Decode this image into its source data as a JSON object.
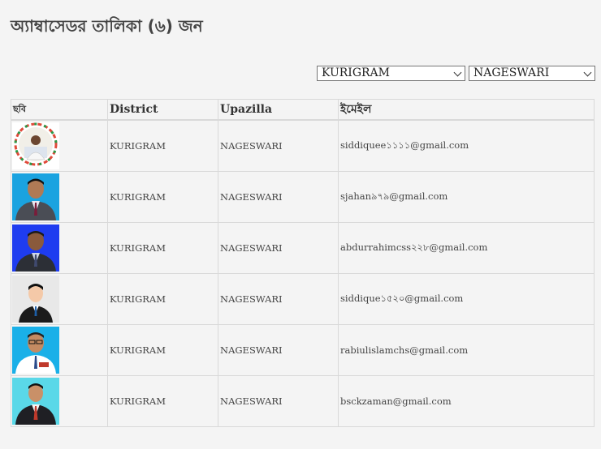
{
  "page": {
    "title": "অ্যাম্বাসেডর তালিকা (৬) জন"
  },
  "filters": {
    "district": "KURIGRAM",
    "upazilla": "NAGESWARI"
  },
  "table": {
    "headers": [
      "ছবি",
      "District",
      "Upazilla",
      "ইমেইল"
    ],
    "rows": [
      {
        "district": "KURIGRAM",
        "upazilla": "NAGESWARI",
        "email": "siddiquee১১১১@gmail.com"
      },
      {
        "district": "KURIGRAM",
        "upazilla": "NAGESWARI",
        "email": "sjahan৯৭৯@gmail.com"
      },
      {
        "district": "KURIGRAM",
        "upazilla": "NAGESWARI",
        "email": "abdurrahimcss২২৮@gmail.com"
      },
      {
        "district": "KURIGRAM",
        "upazilla": "NAGESWARI",
        "email": "siddique১৫২০@gmail.com"
      },
      {
        "district": "KURIGRAM",
        "upazilla": "NAGESWARI",
        "email": "rabiulislamchs@gmail.com"
      },
      {
        "district": "KURIGRAM",
        "upazilla": "NAGESWARI",
        "email": "bsckzaman@gmail.com"
      }
    ]
  },
  "colors": {
    "page_bg": "#f4f4f4",
    "border": "#d9d9d9",
    "photo_bg_1": "#ffffff",
    "photo_bg_2": "#1aa3e0",
    "photo_bg_3": "#1e3cf0",
    "photo_bg_4": "#e8e8e8",
    "photo_bg_5": "#1ab0e8",
    "photo_bg_6": "#5ad8e8"
  },
  "icons": {
    "select_arrow": "chevron-down-icon",
    "photo": "avatar-photo"
  }
}
